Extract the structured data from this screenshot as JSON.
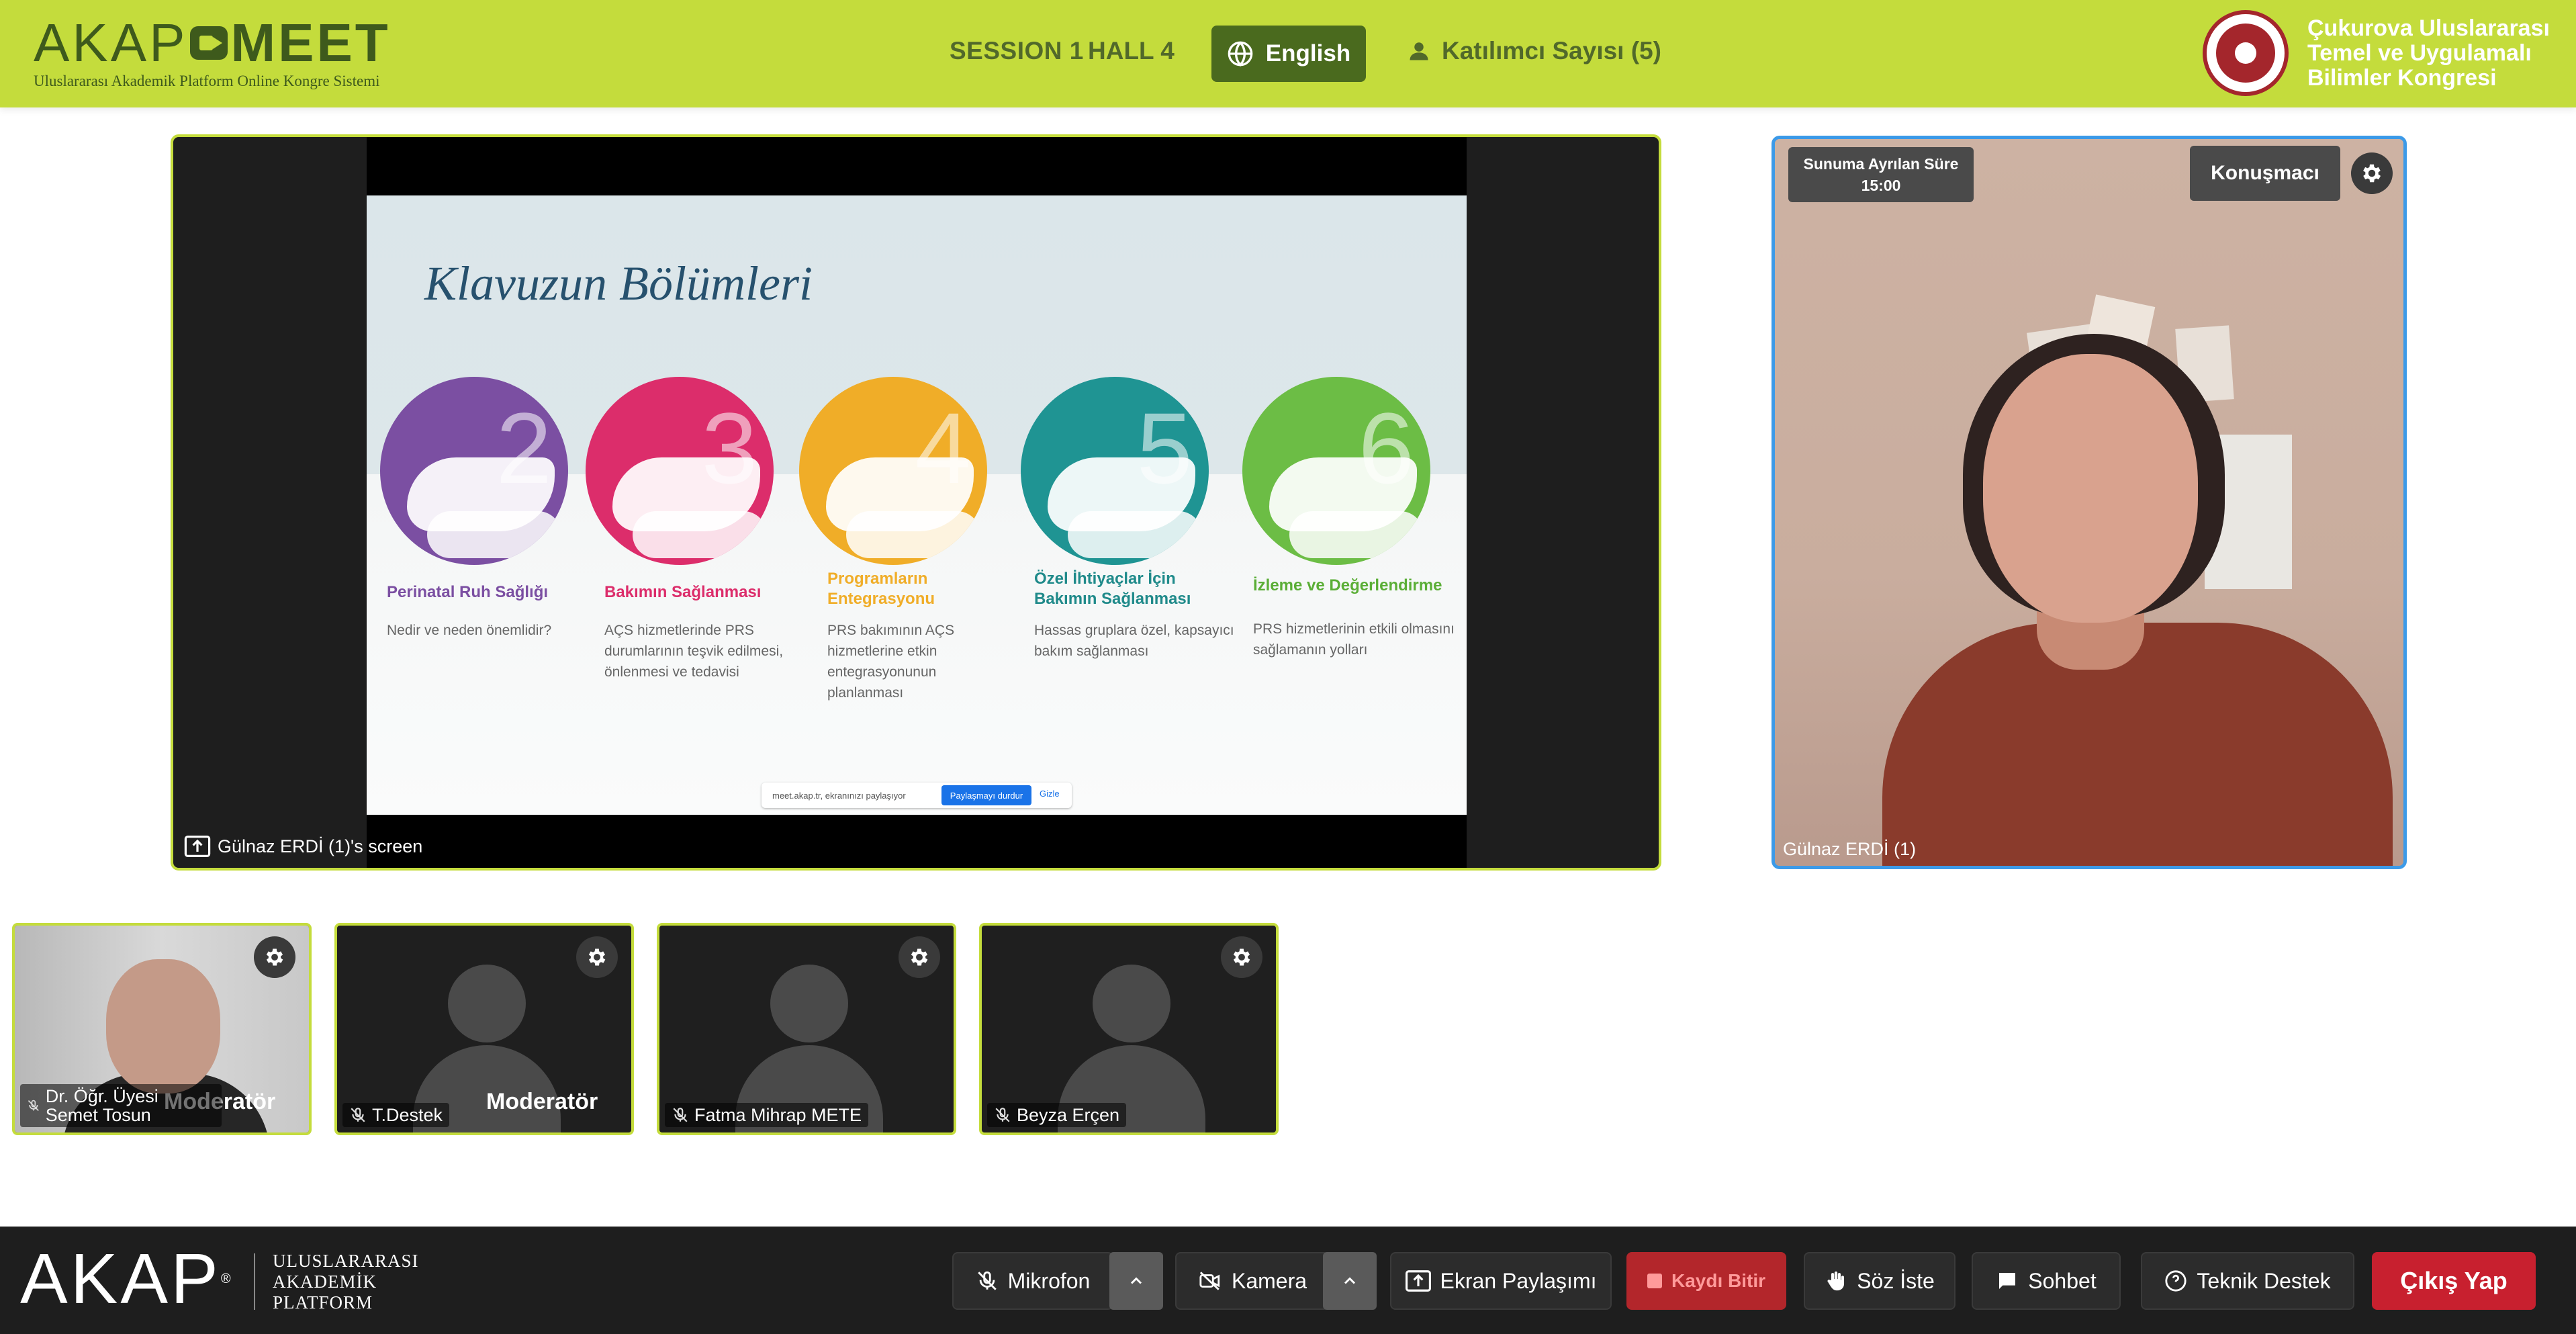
{
  "header": {
    "logo": {
      "left": "AKAP",
      "right": "MEET",
      "subtitle": "Uluslararası Akademik Platform Online Kongre Sistemi"
    },
    "session": "SESSION 1",
    "hall": "HALL 4",
    "language_button": "English",
    "participant_count": "Katılımcı Sayısı (5)",
    "congress_name": "Çukurova Uluslararası Temel ve Uygulamalı Bilimler Kongresi"
  },
  "screen_share": {
    "label": "Gülnaz ERDİ (1)'s screen",
    "slide": {
      "title": "Klavuzun Bölümleri",
      "sections": [
        {
          "number": "2",
          "color": "#7b4fa2",
          "title": "Perinatal Ruh Sağlığı",
          "description": "Nedir ve neden önemlidir?"
        },
        {
          "number": "3",
          "color": "#dc2d6b",
          "title": "Bakımın Sağlanması",
          "description": "AÇS hizmetlerinde PRS durumlarının teşvik edilmesi, önlenmesi ve tedavisi"
        },
        {
          "number": "4",
          "color": "#f0ad28",
          "title": "Programların Entegrasyonu",
          "description": "PRS bakımının AÇS hizmetlerine etkin entegrasyonunun planlanması"
        },
        {
          "number": "5",
          "color": "#1f9493",
          "title": "Özel İhtiyaçlar İçin Bakımın Sağlanması",
          "description": "Hassas gruplara özel, kapsayıcı bakım sağlanması"
        },
        {
          "number": "6",
          "color": "#6cbd45",
          "title": "İzleme ve Değerlendirme",
          "description": "PRS hizmetlerinin etkili olmasını sağlamanın yolları"
        }
      ],
      "share_notice": {
        "text": "meet.akap.tr, ekranınızı paylaşıyor",
        "stop_label": "Paylaşmayı durdur",
        "hide_label": "Gizle"
      }
    }
  },
  "speaker": {
    "timer_label": "Sunuma Ayrılan Süre",
    "timer_value": "15:00",
    "role_button": "Konuşmacı",
    "name": "Gülnaz ERDİ (1)"
  },
  "participants": [
    {
      "name": "Dr. Öğr. Üyesi Semet Tosun",
      "badge": "Moderatör",
      "has_video": true
    },
    {
      "name": "T.Destek",
      "badge": "Moderatör",
      "has_video": false
    },
    {
      "name": "Fatma Mihrap METE",
      "badge": "",
      "has_video": false
    },
    {
      "name": "Beyza Erçen",
      "badge": "",
      "has_video": false
    }
  ],
  "footer": {
    "logo": "AKAP",
    "logo_mark": "®",
    "logo_subtitle": [
      "ULUSLARARASI",
      "AKADEMİK",
      "PLATFORM"
    ],
    "controls": {
      "microphone": "Mikrofon",
      "camera": "Kamera",
      "screen_share": "Ekran Paylaşımı",
      "stop_recording": "Kaydı Bitir",
      "raise_hand": "Söz İste",
      "chat": "Sohbet",
      "support": "Teknik Destek",
      "exit": "Çıkış Yap"
    }
  },
  "colors": {
    "brand_green": "#c4dc3c",
    "brand_dark_green": "#4a6a1e",
    "active_speaker_border": "#3c9ae8",
    "record_red": "#b3262b",
    "exit_red": "#c8202f"
  }
}
